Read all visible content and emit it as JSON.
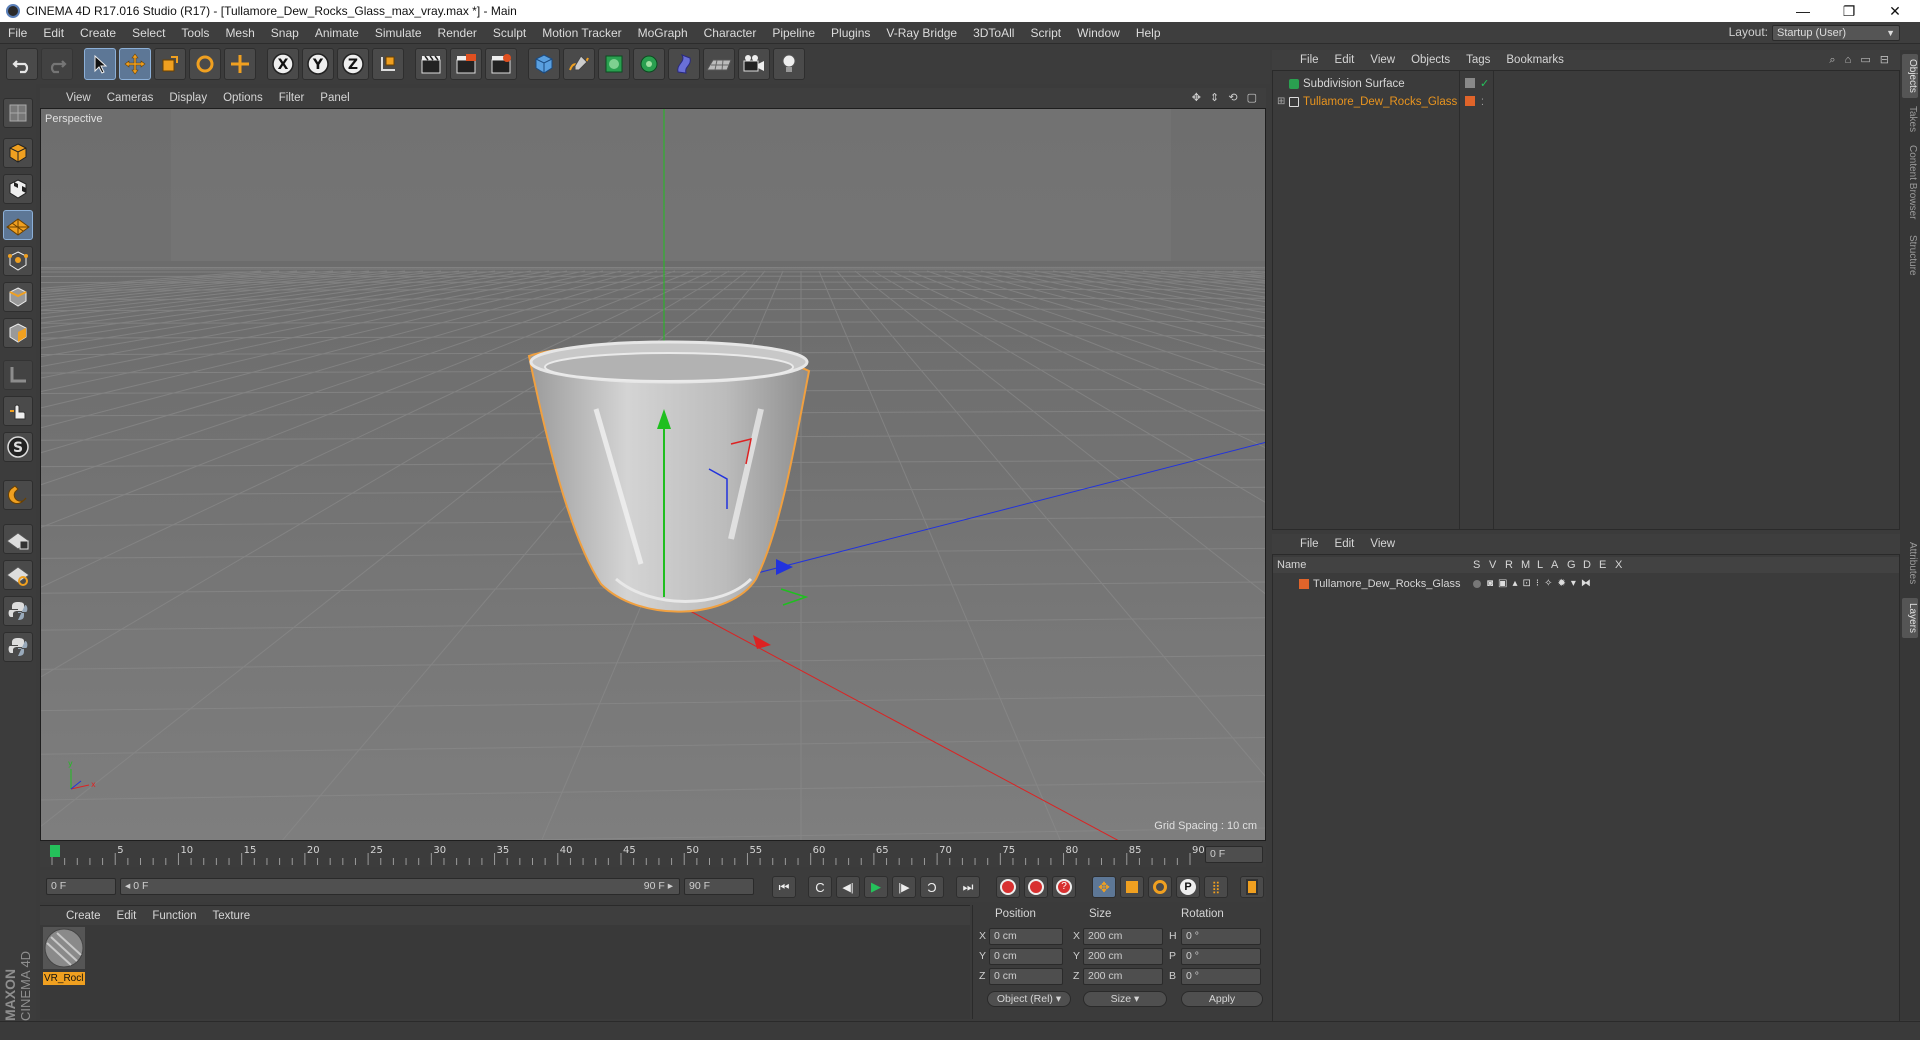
{
  "window": {
    "title": "CINEMA 4D R17.016 Studio (R17) - [Tullamore_Dew_Rocks_Glass_max_vray.max *] - Main",
    "min_glyph": "—",
    "restore_glyph": "❐",
    "close_glyph": "✕"
  },
  "menubar": {
    "items": [
      "File",
      "Edit",
      "Create",
      "Select",
      "Tools",
      "Mesh",
      "Snap",
      "Animate",
      "Simulate",
      "Render",
      "Sculpt",
      "Motion Tracker",
      "MoGraph",
      "Character",
      "Pipeline",
      "Plugins",
      "V-Ray Bridge",
      "3DToAll",
      "Script",
      "Window",
      "Help"
    ],
    "layout_label": "Layout:",
    "layout_value": "Startup (User)"
  },
  "toolbar": {
    "axis_x": "X",
    "axis_y": "Y",
    "axis_z": "Z"
  },
  "viewport": {
    "menu": [
      "View",
      "Cameras",
      "Display",
      "Options",
      "Filter",
      "Panel"
    ],
    "label": "Perspective",
    "grid_spacing": "Grid Spacing : 10 cm"
  },
  "timeline": {
    "ticks": [
      "0",
      "5",
      "10",
      "15",
      "20",
      "25",
      "30",
      "35",
      "40",
      "45",
      "50",
      "55",
      "60",
      "65",
      "70",
      "75",
      "80",
      "85",
      "90"
    ],
    "current_frame": "0 F",
    "start_field": "0 F",
    "range_start": "◂ 0 F",
    "range_end": "90 F ▸",
    "end_field": "90 F"
  },
  "material_manager": {
    "menu": [
      "Create",
      "Edit",
      "Function",
      "Texture"
    ],
    "materials": [
      {
        "name": "VR_Rocl"
      }
    ]
  },
  "coordinates": {
    "headers": {
      "position": "Position",
      "size": "Size",
      "rotation": "Rotation"
    },
    "rows": [
      {
        "axis": "X",
        "pos": "0 cm",
        "size_axis": "X",
        "size": "200 cm",
        "rot_axis": "H",
        "rot": "0 °"
      },
      {
        "axis": "Y",
        "pos": "0 cm",
        "size_axis": "Y",
        "size": "200 cm",
        "rot_axis": "P",
        "rot": "0 °"
      },
      {
        "axis": "Z",
        "pos": "0 cm",
        "size_axis": "Z",
        "size": "200 cm",
        "rot_axis": "B",
        "rot": "0 °"
      }
    ],
    "mode_select": "Object (Rel)",
    "size_select": "Size",
    "apply": "Apply"
  },
  "object_manager": {
    "menu": [
      "File",
      "Edit",
      "View",
      "Objects",
      "Tags",
      "Bookmarks"
    ],
    "objects": [
      {
        "name": "Subdivision Surface",
        "color": "#d6d6d6"
      },
      {
        "name": "Tullamore_Dew_Rocks_Glass",
        "color": "#e8941f"
      }
    ]
  },
  "layer_manager": {
    "menu": [
      "File",
      "Edit",
      "View"
    ],
    "columns": [
      "Name",
      "S",
      "V",
      "R",
      "M",
      "L",
      "A",
      "G",
      "D",
      "E",
      "X"
    ],
    "layers": [
      {
        "name": "Tullamore_Dew_Rocks_Glass",
        "color": "#e0642a"
      }
    ]
  },
  "side_tabs": [
    "Objects",
    "Takes",
    "Content Browser",
    "Structure"
  ],
  "side_tabs_lower": [
    "Attributes",
    "Layers"
  ],
  "brand": {
    "line1": "MAXON",
    "line2": "CINEMA 4D"
  },
  "colors": {
    "accent": "#e8941f",
    "selection_outline": "#f0a040",
    "x_axis": "#e02020",
    "y_axis": "#20c020",
    "z_axis": "#2040e0"
  }
}
